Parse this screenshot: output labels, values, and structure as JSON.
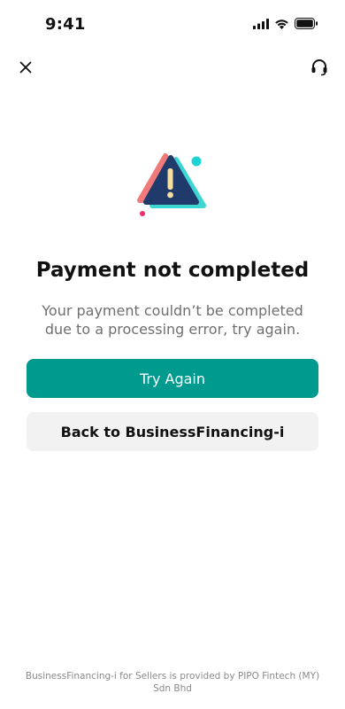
{
  "status_bar": {
    "time": "9:41",
    "icons": [
      "signal-icon",
      "wifi-icon",
      "battery-icon"
    ]
  },
  "nav": {
    "close_icon": "close-icon",
    "support_icon": "headset-icon"
  },
  "illustration": {
    "icon": "warning-triangle-icon",
    "colors": {
      "triangle": "#1f3a6b",
      "back_pink": "#f07a7a",
      "back_teal": "#3ed6d2",
      "exclaim": "#f4dfa0",
      "dot_teal": "#1ed3d6",
      "dot_pink": "#ef2f6a"
    }
  },
  "content": {
    "title": "Payment not completed",
    "message": "Your payment couldn’t be completed due to a processing error, try again."
  },
  "actions": {
    "primary_label": "Try Again",
    "secondary_label": "Back to BusinessFinancing-i"
  },
  "footer": {
    "text": "BusinessFinancing-i for Sellers is provided by PIPO Fintech (MY) Sdn Bhd"
  },
  "colors": {
    "primary": "#009a8f",
    "secondary_bg": "#f2f2f2",
    "text": "#111111",
    "muted_text": "#6f6f6f"
  }
}
